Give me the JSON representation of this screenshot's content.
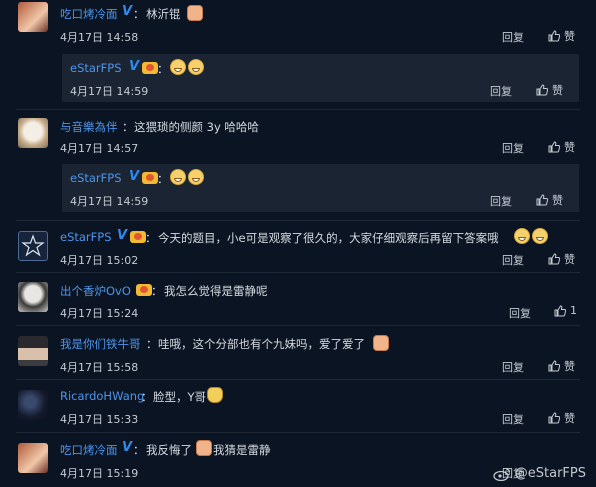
{
  "reply_label": "回复",
  "like_label": "赞",
  "comments": [
    {
      "name": "吃口烤冷面",
      "verified": true,
      "text": "林沂锟",
      "time": "4月17日 14:58"
    },
    {
      "name": "eStarFPS",
      "text": "",
      "time": "4月17日 14:59"
    },
    {
      "name": "与音樂為伴",
      "text": "这猥琐的侧颜 3y 哈哈哈",
      "time": "4月17日 14:57"
    },
    {
      "name": "eStarFPS",
      "text": "",
      "time": "4月17日 14:59"
    },
    {
      "name": "eStarFPS",
      "text": "今天的题目，小e可是观察了很久的，大家仔细观察后再留下答案哦",
      "time": "4月17日 15:02"
    },
    {
      "name": "出个香炉OvO",
      "text": "我怎么觉得是雷静呢",
      "time": "4月17日 15:24",
      "likes": "1"
    },
    {
      "name": "我是你们铁牛哥",
      "text": "哇哦，这个分部也有个九妹吗，爱了爱了",
      "time": "4月17日 15:58"
    },
    {
      "name": "RicardoHWang",
      "text": "脸型，Y哥",
      "time": "4月17日 15:33"
    },
    {
      "name": "吃口烤冷面",
      "text_a": "我反悔了",
      "text_b": "我猜是雷静",
      "time": "4月17日 15:19"
    }
  ],
  "colon": "：",
  "watermark": "@eStarFPS"
}
